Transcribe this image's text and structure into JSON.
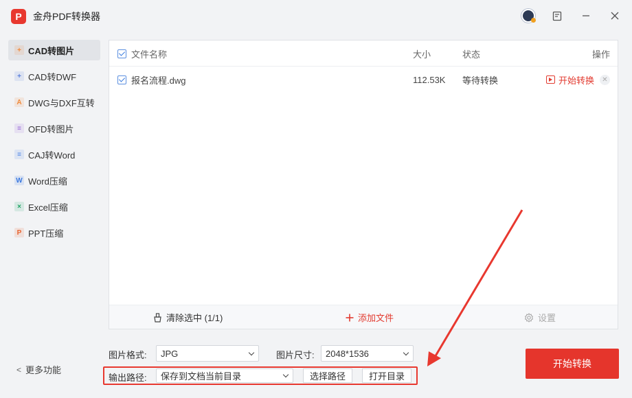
{
  "app": {
    "title": "金舟PDF转换器",
    "logo_letter": "P"
  },
  "sidebar": {
    "items": [
      {
        "label": "CAD转图片",
        "icon": "cad-image-icon",
        "color": "#f08a3c",
        "glyph": "+"
      },
      {
        "label": "CAD转DWF",
        "icon": "cad-dwf-icon",
        "color": "#5a7fdc",
        "glyph": "+"
      },
      {
        "label": "DWG与DXF互转",
        "icon": "dwg-dxf-icon",
        "color": "#f08a3c",
        "glyph": "A"
      },
      {
        "label": "OFD转图片",
        "icon": "ofd-icon",
        "color": "#9b6ad8",
        "glyph": "≡"
      },
      {
        "label": "CAJ转Word",
        "icon": "caj-icon",
        "color": "#4f86e6",
        "glyph": "≡"
      },
      {
        "label": "Word压缩",
        "icon": "word-compress-icon",
        "color": "#3d7ae0",
        "glyph": "W"
      },
      {
        "label": "Excel压缩",
        "icon": "excel-compress-icon",
        "color": "#21a366",
        "glyph": "×"
      },
      {
        "label": "PPT压缩",
        "icon": "ppt-compress-icon",
        "color": "#e8632f",
        "glyph": "P"
      }
    ],
    "more_label": "更多功能"
  },
  "table": {
    "headers": {
      "name": "文件名称",
      "size": "大小",
      "status": "状态",
      "action": "操作"
    },
    "rows": [
      {
        "name": "报名流程.dwg",
        "size": "112.53K",
        "status": "等待转换",
        "action": "开始转换"
      }
    ]
  },
  "footer": {
    "clear": "清除选中 (1/1)",
    "add": "添加文件",
    "settings": "设置"
  },
  "options": {
    "format_label": "图片格式:",
    "format_value": "JPG",
    "size_label": "图片尺寸:",
    "size_value": "2048*1536",
    "output_label": "输出路径:",
    "output_value": "保存到文档当前目录",
    "choose_path": "选择路径",
    "open_dir": "打开目录"
  },
  "start_button": "开始转换",
  "colors": {
    "accent": "#e5352c",
    "check": "#3b7de0"
  }
}
